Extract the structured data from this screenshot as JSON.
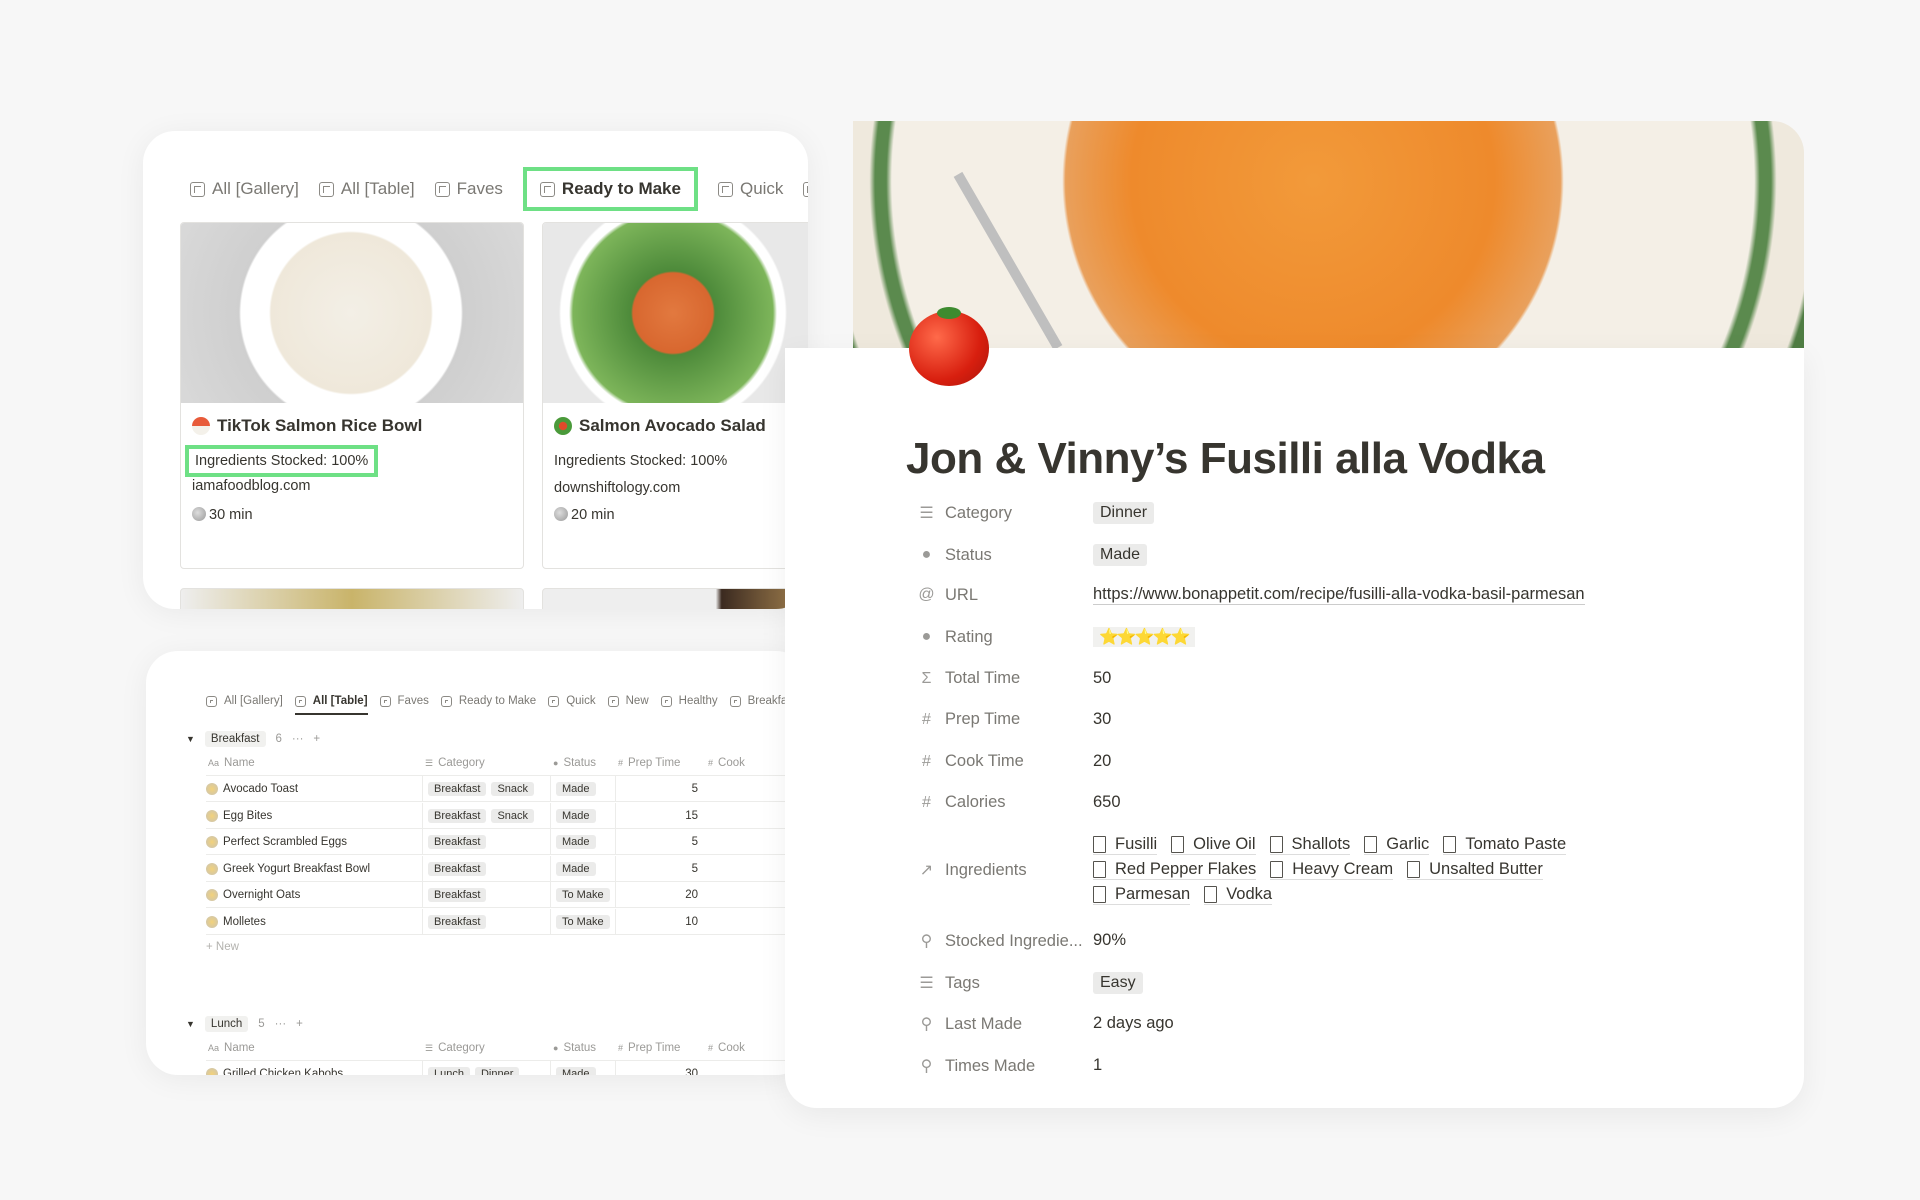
{
  "gallery": {
    "tabs": [
      "All [Gallery]",
      "All [Table]",
      "Faves",
      "Ready to Make",
      "Quick"
    ],
    "active_tab": "Ready to Make",
    "cards": [
      {
        "title": "TikTok Salmon Rice Bowl",
        "emoji": "sushi-icon",
        "stocked": "Ingredients Stocked: 100%",
        "source": "iamafoodblog.com",
        "time": "30 min"
      },
      {
        "title": "Salmon Avocado Salad",
        "emoji": "salad-icon",
        "stocked": "Ingredients Stocked: 100%",
        "source": "downshiftology.com",
        "time": "20 min"
      }
    ]
  },
  "table": {
    "tabs": [
      "All [Gallery]",
      "All [Table]",
      "Faves",
      "Ready to Make",
      "Quick",
      "New",
      "Healthy",
      "Breakfa"
    ],
    "active_tab": "All [Table]",
    "columns": [
      "Name",
      "Category",
      "Status",
      "Prep Time",
      "Cook"
    ],
    "new_label": "New",
    "groups": [
      {
        "name": "Breakfast",
        "count": "6",
        "rows": [
          {
            "name": "Avocado Toast",
            "category": [
              "Breakfast",
              "Snack"
            ],
            "status": "Made",
            "prep": "5"
          },
          {
            "name": "Egg Bites",
            "category": [
              "Breakfast",
              "Snack"
            ],
            "status": "Made",
            "prep": "15"
          },
          {
            "name": "Perfect Scrambled Eggs",
            "category": [
              "Breakfast"
            ],
            "status": "Made",
            "prep": "5"
          },
          {
            "name": "Greek Yogurt Breakfast Bowl",
            "category": [
              "Breakfast"
            ],
            "status": "Made",
            "prep": "5"
          },
          {
            "name": "Overnight Oats",
            "category": [
              "Breakfast"
            ],
            "status": "To Make",
            "prep": "20"
          },
          {
            "name": "Molletes",
            "category": [
              "Breakfast"
            ],
            "status": "To Make",
            "prep": "10"
          }
        ]
      },
      {
        "name": "Lunch",
        "count": "5",
        "rows": [
          {
            "name": "Grilled Chicken Kabobs",
            "category": [
              "Lunch",
              "Dinner"
            ],
            "status": "Made",
            "prep": "30"
          }
        ]
      }
    ]
  },
  "detail": {
    "title": "Jon & Vinny’s Fusilli alla Vodka",
    "properties": [
      {
        "icon": "list-icon",
        "label": "Category",
        "type": "pill",
        "value": [
          "Dinner"
        ]
      },
      {
        "icon": "status-icon",
        "label": "Status",
        "type": "pill",
        "value": [
          "Made"
        ]
      },
      {
        "icon": "link-icon",
        "label": "URL",
        "type": "text",
        "value": "https://www.bonappetit.com/recipe/fusilli-alla-vodka-basil-parmesan"
      },
      {
        "icon": "rating-icon",
        "label": "Rating",
        "type": "stars",
        "value": "⭐⭐⭐⭐⭐",
        "rating": 5
      },
      {
        "icon": "sigma-icon",
        "label": "Total Time",
        "type": "text",
        "value": "50"
      },
      {
        "icon": "hash-icon",
        "label": "Prep Time",
        "type": "text",
        "value": "30"
      },
      {
        "icon": "hash-icon",
        "label": "Cook Time",
        "type": "text",
        "value": "20"
      },
      {
        "icon": "hash-icon",
        "label": "Calories",
        "type": "text",
        "value": "650"
      },
      {
        "icon": "relation-arrow-icon",
        "label": "Ingredients",
        "type": "relation",
        "value": [
          "Fusilli",
          "Olive Oil",
          "Shallots",
          "Garlic",
          "Tomato Paste",
          "Red Pepper Flakes",
          "Heavy Cream",
          "Unsalted Butter",
          "Parmesan",
          "Vodka"
        ]
      },
      {
        "icon": "search-icon",
        "label": "Stocked Ingredie...",
        "type": "text",
        "value": "90%"
      },
      {
        "icon": "list-icon",
        "label": "Tags",
        "type": "pill",
        "value": [
          "Easy"
        ]
      },
      {
        "icon": "search-icon",
        "label": "Last Made",
        "type": "text",
        "value": "2 days ago"
      },
      {
        "icon": "search-icon",
        "label": "Times Made",
        "type": "text",
        "value": "1"
      }
    ]
  },
  "colors": {
    "highlight": "#6ee085",
    "background": "#f7f7f7"
  }
}
